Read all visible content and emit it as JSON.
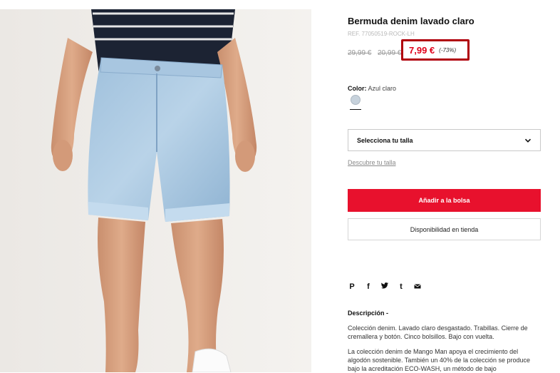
{
  "product": {
    "title": "Bermuda denim lavado claro",
    "ref": "REF. 77050519-ROCK-LH",
    "old_price_1": "29,99 €",
    "old_price_2": "20,99 €",
    "price": "7,99 €",
    "discount": "(-73%)",
    "color_label": "Color:",
    "color_value": "Azul claro",
    "swatch_color": "#c7d2dc"
  },
  "size": {
    "select_label": "Selecciona tu talla",
    "guide_link": "Descubre tu talla"
  },
  "actions": {
    "add_to_bag": "Añadir a la bolsa",
    "store_availability": "Disponibilidad en tienda",
    "accent_color": "#e8112d"
  },
  "share": {
    "icons": [
      "pinterest-icon",
      "facebook-icon",
      "twitter-icon",
      "tumblr-icon",
      "mail-icon"
    ],
    "glyphs": [
      "P",
      "f",
      "🐦",
      "t",
      "✉"
    ]
  },
  "description": {
    "title": "Descripción -",
    "paragraph_1": "Colección denim. Lavado claro desgastado. Trabillas. Cierre de cremallera y botón. Cinco bolsillos. Bajo con vuelta.",
    "paragraph_2": "La colección denim de Mango Man apoya el crecimiento del algodón sostenible. También un 40% de la colección se produce bajo la acreditación ECO-WASH, un método de bajo"
  }
}
